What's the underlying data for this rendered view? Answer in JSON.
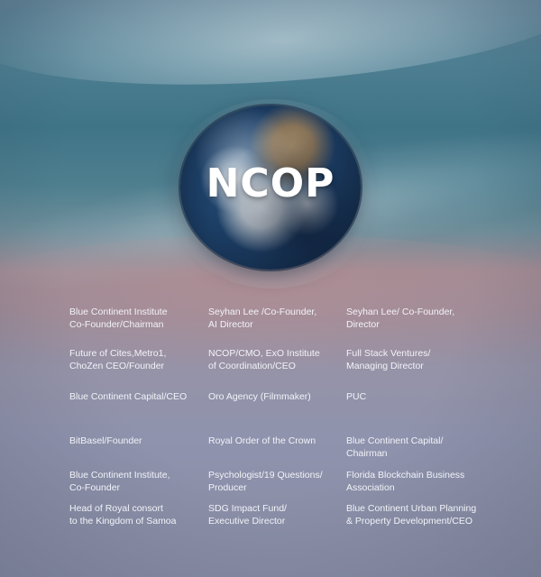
{
  "title": "NCOP",
  "rows": [
    [
      "Blue Continent Institute\nCo-Founder/Chairman",
      "Seyhan Lee /Co-Founder,\nAI Director",
      "Seyhan Lee/ Co-Founder,\nDirector"
    ],
    [
      "Future of Cites,Metro1,\nChoZen CEO/Founder",
      "NCOP/CMO, ExO Institute\nof Coordination/CEO",
      "Full Stack Ventures/\nManaging Director"
    ],
    [
      "Blue Continent Capital/CEO",
      "Oro Agency (Filmmaker)",
      "PUC"
    ],
    [
      "BitBasel/Founder",
      "Royal Order of the Crown",
      "Blue Continent Capital/\nChairman"
    ],
    [
      "Blue Continent Institute,\nCo-Founder",
      "Psychologist/19 Questions/\nProducer",
      "Florida Blockchain Business\nAssociation"
    ],
    [
      "Head of Royal consort\nto the Kingdom of Samoa",
      "SDG Impact Fund/\nExecutive Director",
      "Blue Continent Urban Planning\n& Property Development/CEO"
    ]
  ]
}
